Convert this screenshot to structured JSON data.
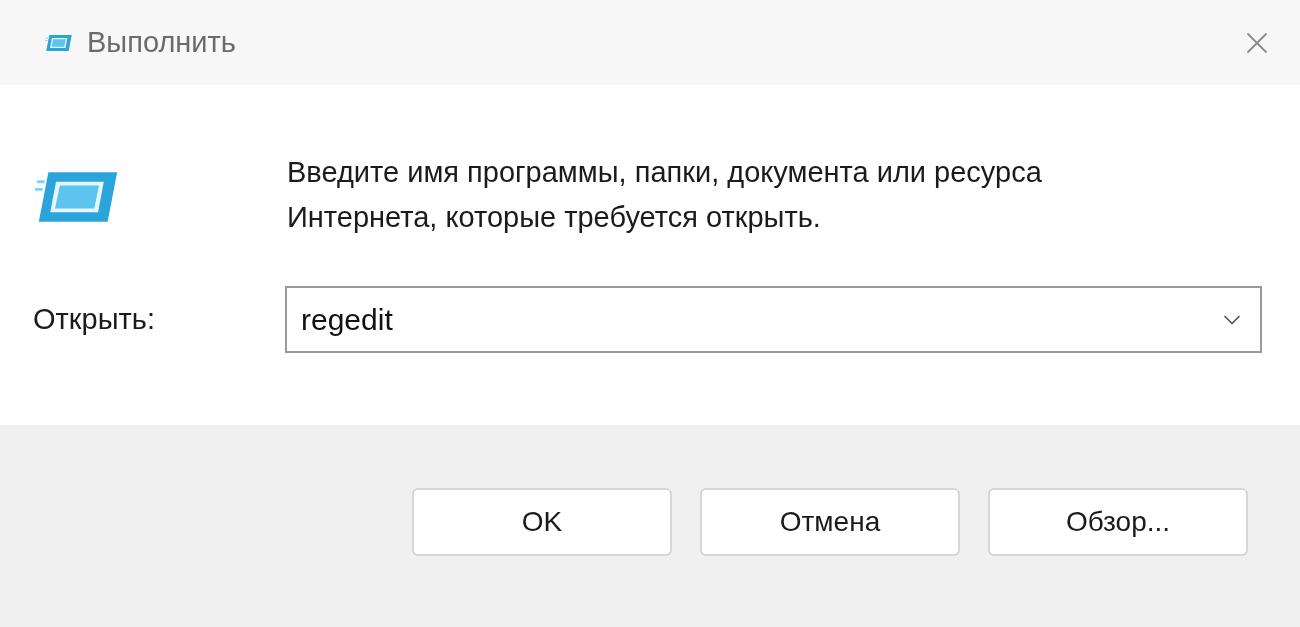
{
  "window": {
    "title": "Выполнить"
  },
  "prompt": "Введите имя программы, папки, документа или ресурса Интернета, которые требуется открыть.",
  "open_field": {
    "label": "Открыть:",
    "value": "regedit"
  },
  "buttons": [
    {
      "label": "OK"
    },
    {
      "label": "Отмена"
    },
    {
      "label": "Обзор..."
    }
  ]
}
